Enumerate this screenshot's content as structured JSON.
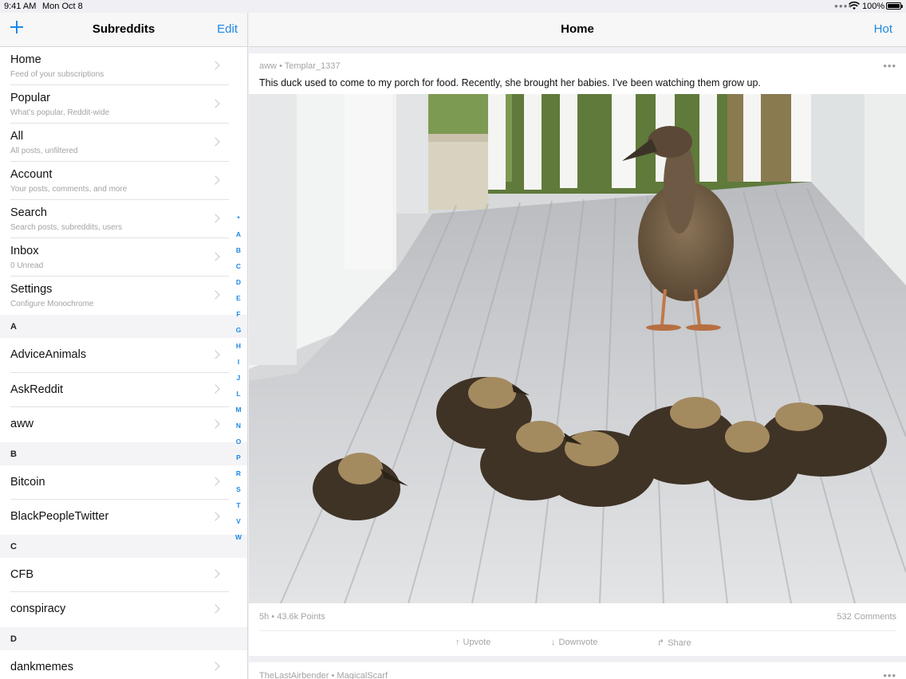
{
  "status_bar": {
    "time": "9:41 AM",
    "date": "Mon Oct 8",
    "battery": "100%"
  },
  "sidebar": {
    "title": "Subreddits",
    "edit_label": "Edit",
    "menu": [
      {
        "label": "Home",
        "sub": "Feed of your subscriptions"
      },
      {
        "label": "Popular",
        "sub": "What's popular, Reddit-wide"
      },
      {
        "label": "All",
        "sub": "All posts, unfiltered"
      },
      {
        "label": "Account",
        "sub": "Your posts, comments, and more"
      },
      {
        "label": "Search",
        "sub": "Search posts, subreddits, users"
      },
      {
        "label": "Inbox",
        "sub": "0 Unread"
      },
      {
        "label": "Settings",
        "sub": "Configure Monochrome"
      }
    ],
    "sections": [
      {
        "letter": "A",
        "items": [
          "AdviceAnimals",
          "AskReddit",
          "aww"
        ]
      },
      {
        "letter": "B",
        "items": [
          "Bitcoin",
          "BlackPeopleTwitter"
        ]
      },
      {
        "letter": "C",
        "items": [
          "CFB",
          "conspiracy"
        ]
      },
      {
        "letter": "D",
        "items": [
          "dankmemes"
        ]
      }
    ],
    "index": [
      "*",
      "A",
      "B",
      "C",
      "D",
      "E",
      "F",
      "G",
      "H",
      "I",
      "J",
      "L",
      "M",
      "N",
      "O",
      "P",
      "R",
      "S",
      "T",
      "V",
      "W"
    ]
  },
  "main": {
    "title": "Home",
    "sort_label": "Hot",
    "post": {
      "subreddit": "aww",
      "author": "Templar_1337",
      "title": "This duck used to come to my porch for food. Recently, she brought her babies. I've been watching them grow up.",
      "age": "5h",
      "points": "43.6k Points",
      "comments": "532 Comments",
      "upvote_label": "Upvote",
      "downvote_label": "Downvote",
      "share_label": "Share"
    },
    "next_post": {
      "subreddit": "TheLastAirbender",
      "author": "MagicalScarf"
    }
  },
  "colors": {
    "accent": "#1e88e5",
    "secondary_text": "#a3a3a8"
  }
}
